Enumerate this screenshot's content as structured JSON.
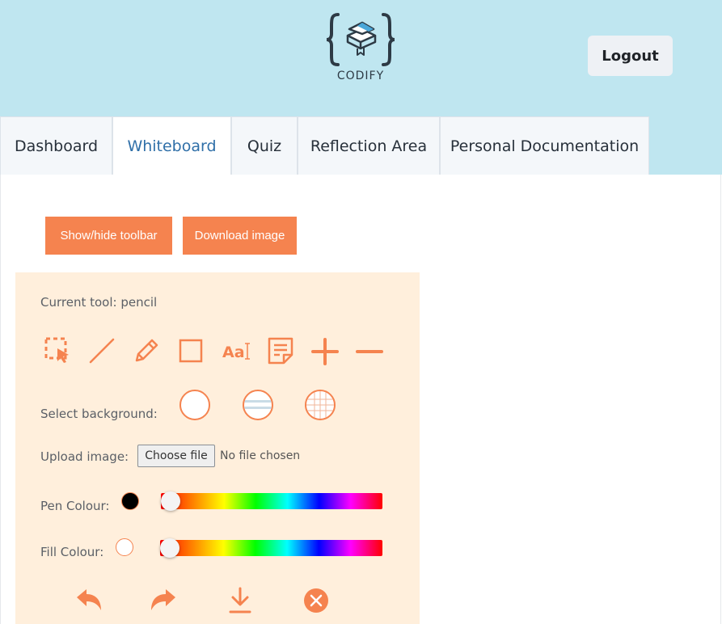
{
  "header": {
    "brand": "CODIFY",
    "logout_label": "Logout",
    "logo_icon": "books-braces-logo-icon"
  },
  "tabs": [
    {
      "label": "Dashboard",
      "active": false
    },
    {
      "label": "Whiteboard",
      "active": true
    },
    {
      "label": "Quiz",
      "active": false
    },
    {
      "label": "Reflection Area",
      "active": false
    },
    {
      "label": "Personal Documentation",
      "active": false
    }
  ],
  "actions": {
    "toggle_toolbar_label": "Show/hide toolbar",
    "download_label": "Download image"
  },
  "toolbar": {
    "current_tool_text": "Current tool: pencil",
    "tools": [
      "select-icon",
      "line-icon",
      "pencil-icon",
      "rectangle-icon",
      "text-icon",
      "sticky-note-icon",
      "zoom-in-icon",
      "zoom-out-icon"
    ],
    "background_label": "Select background:",
    "backgrounds": [
      "blank",
      "lined",
      "grid"
    ],
    "upload_label": "Upload image:",
    "choose_file_label": "Choose file",
    "file_status": "No file chosen",
    "pen_colour_label": "Pen Colour:",
    "pen_colour": "#000000",
    "pen_slider_value": 0,
    "fill_colour_label": "Fill Colour:",
    "fill_colour": "#ffffff",
    "fill_slider_value": 0,
    "bottom_actions": [
      "undo-icon",
      "redo-icon",
      "download-icon",
      "clear-icon"
    ]
  },
  "colors": {
    "header_bg": "#bfe6f0",
    "accent": "#f5834f",
    "toolbar_bg": "#ffefdc",
    "active_tab_text": "#2f6fa8"
  }
}
